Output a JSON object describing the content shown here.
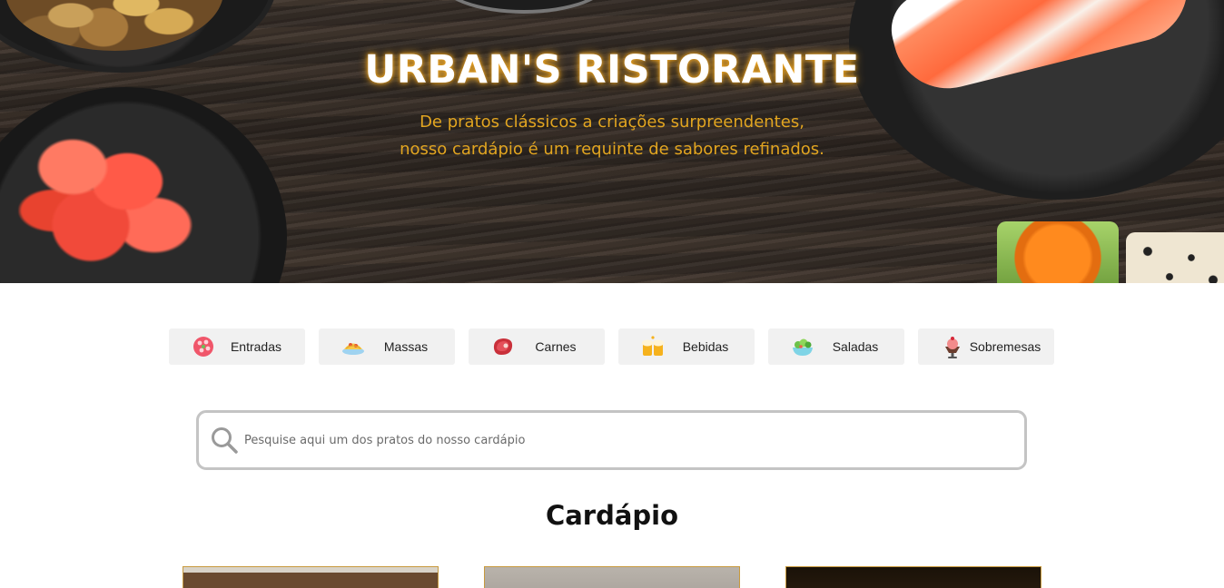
{
  "hero": {
    "title": "URBAN'S RISTORANTE",
    "subtitle_line1": "De pratos clássicos a criações surpreendentes,",
    "subtitle_line2": "nosso cardápio é um requinte de sabores refinados."
  },
  "categories": [
    {
      "label": "Entradas",
      "icon": "appetizer-icon"
    },
    {
      "label": "Massas",
      "icon": "pasta-icon"
    },
    {
      "label": "Carnes",
      "icon": "meat-icon"
    },
    {
      "label": "Bebidas",
      "icon": "beer-icon"
    },
    {
      "label": "Saladas",
      "icon": "salad-icon"
    },
    {
      "label": "Sobremesas",
      "icon": "dessert-icon"
    }
  ],
  "search": {
    "placeholder": "Pesquise aqui um dos pratos do nosso cardápio",
    "value": ""
  },
  "menu": {
    "title": "Cardápio"
  },
  "colors": {
    "accent": "#e2a520",
    "category_bg": "#f1f1f1",
    "search_border": "#c4c4c4",
    "card_border": "#c89a3e"
  }
}
